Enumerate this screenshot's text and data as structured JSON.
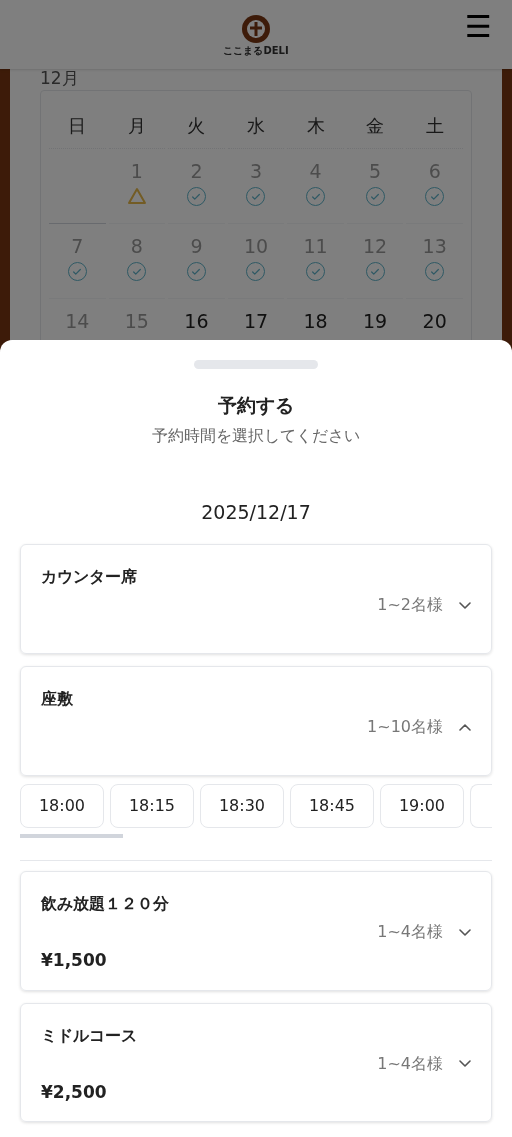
{
  "header": {
    "logo_text": "ここまるDELI",
    "menu_icon": "☰"
  },
  "calendar": {
    "month": "12月",
    "weekdays": [
      "日",
      "月",
      "火",
      "水",
      "木",
      "金",
      "土"
    ],
    "weeks": [
      [
        {
          "kind": "blank"
        },
        {
          "kind": "few",
          "day": "1",
          "past": true
        },
        {
          "kind": "available",
          "day": "2",
          "past": true
        },
        {
          "kind": "available",
          "day": "3",
          "past": true
        },
        {
          "kind": "available",
          "day": "4",
          "past": true
        },
        {
          "kind": "available",
          "day": "5",
          "past": true
        },
        {
          "kind": "available",
          "day": "6",
          "past": true
        }
      ],
      [
        {
          "kind": "available",
          "day": "7",
          "past": true
        },
        {
          "kind": "available",
          "day": "8",
          "past": true
        },
        {
          "kind": "available",
          "day": "9",
          "past": true
        },
        {
          "kind": "available",
          "day": "10",
          "past": true
        },
        {
          "kind": "available",
          "day": "11",
          "past": true
        },
        {
          "kind": "available",
          "day": "12",
          "past": true
        },
        {
          "kind": "available",
          "day": "13",
          "past": true
        }
      ],
      [
        {
          "kind": "plain",
          "day": "14",
          "past": true
        },
        {
          "kind": "plain",
          "day": "15",
          "past": true
        },
        {
          "kind": "plain",
          "day": "16",
          "past": false
        },
        {
          "kind": "plain",
          "day": "17",
          "past": false
        },
        {
          "kind": "plain",
          "day": "18",
          "past": false
        },
        {
          "kind": "plain",
          "day": "19",
          "past": false
        },
        {
          "kind": "plain",
          "day": "20",
          "past": false
        }
      ]
    ]
  },
  "sheet": {
    "title": "予約する",
    "subtitle": "予約時間を選択してください",
    "date": "2025/12/17",
    "plans": [
      {
        "name": "カウンター席",
        "capacity": "1~2名様",
        "expanded": false
      },
      {
        "name": "座敷",
        "capacity": "1~10名様",
        "expanded": true,
        "slots": [
          "18:00",
          "18:15",
          "18:30",
          "18:45",
          "19:00"
        ]
      },
      {
        "name": "飲み放題１２０分",
        "capacity": "1~4名様",
        "price": "¥1,500",
        "expanded": false
      },
      {
        "name": "ミドルコース",
        "capacity": "1~4名様",
        "price": "¥2,500",
        "expanded": false
      }
    ]
  }
}
